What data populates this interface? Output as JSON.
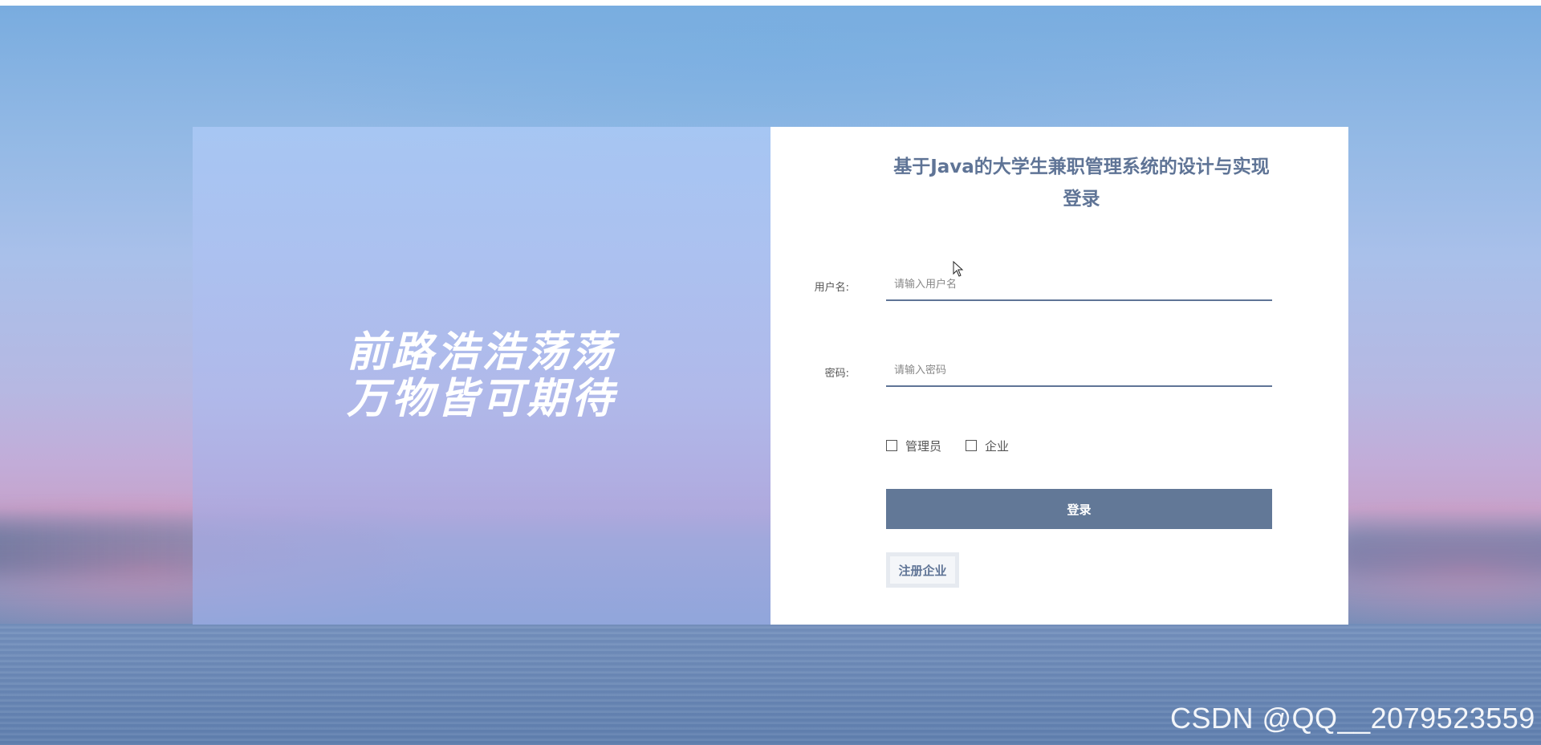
{
  "slogan": {
    "line1": "前路浩浩荡荡",
    "line2": "万物皆可期待"
  },
  "login": {
    "title": "基于Java的大学生兼职管理系统的设计与实现登录",
    "username_label": "用户名:",
    "username_placeholder": "请输入用户名",
    "username_value": "",
    "password_label": "密码:",
    "password_placeholder": "请输入密码",
    "password_value": "",
    "roles": [
      {
        "label": "管理员",
        "checked": false
      },
      {
        "label": "企业",
        "checked": false
      }
    ],
    "submit_label": "登录",
    "register_label": "注册企业"
  },
  "watermark": "CSDN @QQ__2079523559",
  "colors": {
    "accent": "#627897",
    "title": "#5f7496"
  }
}
